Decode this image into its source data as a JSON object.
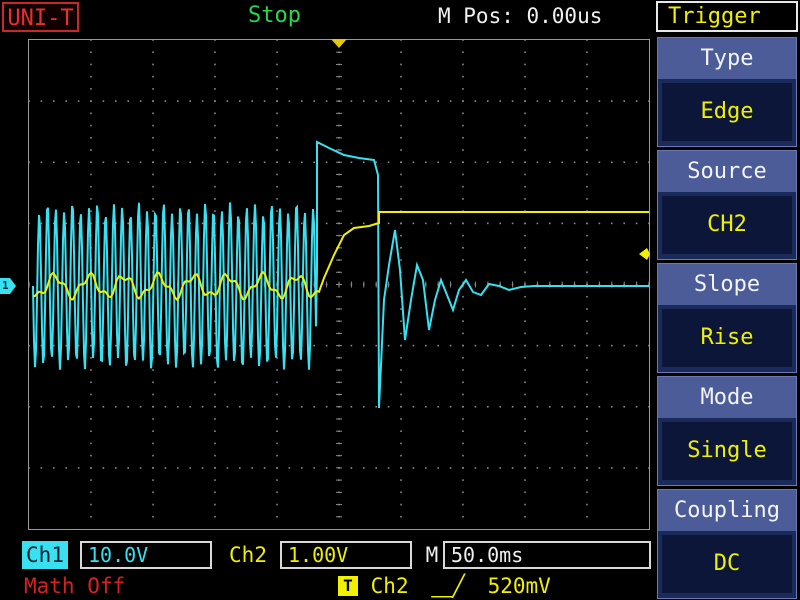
{
  "header": {
    "logo": "UNI-T",
    "status": "Stop",
    "m_pos": "M Pos: 0.00us"
  },
  "menu": {
    "title": "Trigger",
    "items": [
      {
        "label": "Type",
        "value": "Edge"
      },
      {
        "label": "Source",
        "value": "CH2"
      },
      {
        "label": "Slope",
        "value": "Rise"
      },
      {
        "label": "Mode",
        "value": "Single"
      },
      {
        "label": "Coupling",
        "value": "DC"
      }
    ]
  },
  "bottom": {
    "ch1_label": "Ch1",
    "ch1_scale": "10.0V",
    "ch2_label": "Ch2",
    "ch2_scale": "1.00V",
    "m_label": "M",
    "timebase": "50.0ms",
    "math": "Math Off",
    "trigger_badge": "T",
    "trigger_source": "Ch2",
    "trigger_slope_symbol": "⎽╱",
    "trigger_level": "520mV"
  },
  "markers": {
    "ch1_marker": "1"
  },
  "colors": {
    "ch1": "#38e0f0",
    "ch2": "#f0f000",
    "grid": "#8a8a8a",
    "menu_bg": "#1a2a5a",
    "menu_label_bg": "#4c5c98"
  }
}
